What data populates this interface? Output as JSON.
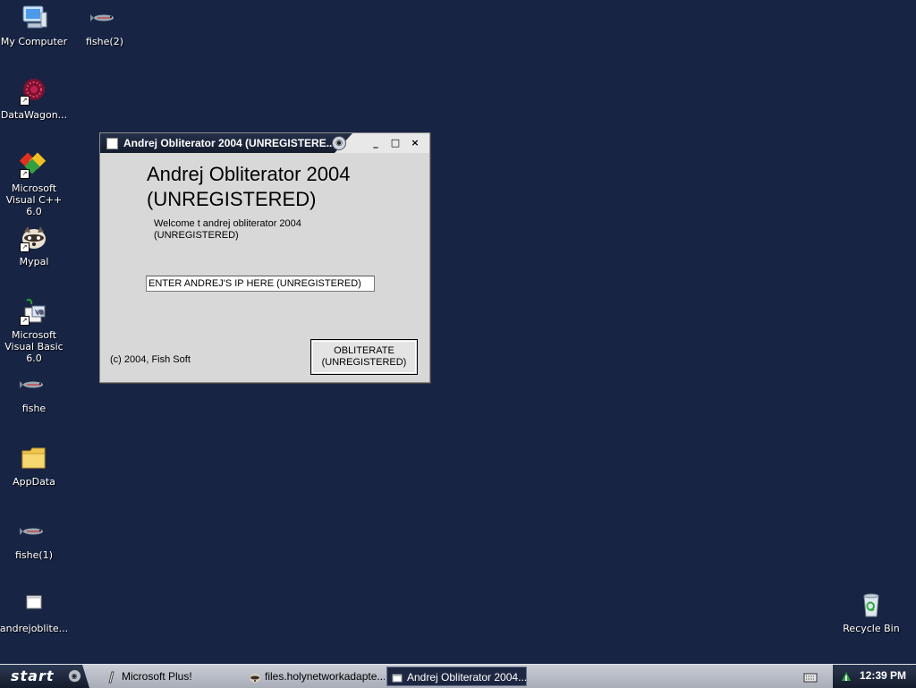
{
  "desktop": {
    "icons": [
      {
        "label": "My Computer",
        "icon": "computer-icon"
      },
      {
        "label": "fishe(2)",
        "icon": "fish-icon"
      },
      {
        "label": "DataWagon...",
        "icon": "datawagon-icon"
      },
      {
        "label": "Microsoft Visual C++ 6.0",
        "icon": "visual-cpp-icon"
      },
      {
        "label": "Mypal",
        "icon": "raccoon-icon"
      },
      {
        "label": "Microsoft Visual Basic 6.0",
        "icon": "visual-basic-icon"
      },
      {
        "label": "fishe",
        "icon": "fish-icon"
      },
      {
        "label": "AppData",
        "icon": "folder-icon"
      },
      {
        "label": "fishe(1)",
        "icon": "fish-icon"
      },
      {
        "label": "andrejoblite...",
        "icon": "file-icon"
      },
      {
        "label": "Recycle Bin",
        "icon": "recycle-bin-icon"
      }
    ]
  },
  "window": {
    "title": "Andrej Obliterator 2004 (UNREGISTERE...",
    "heading_line1": "Andrej Obliterator 2004",
    "heading_line2": "(UNREGISTERED)",
    "welcome_line1": "Welcome t andrej obliterator 2004",
    "welcome_line2": "(UNREGISTERED)",
    "ip_input_value": "ENTER ANDREJ'S IP HERE (UNREGISTERED)",
    "button_line1": "OBLITERATE",
    "button_line2": "(UNREGISTERED)",
    "copyright": "(c) 2004, Fish Soft",
    "controls": {
      "minimize": "_",
      "maximize": "□",
      "close": "×"
    }
  },
  "taskbar": {
    "start_label": "start",
    "tasks": [
      {
        "label": "Microsoft Plus!",
        "icon": "document-icon",
        "active": false
      },
      {
        "label": "files.holynetworkadapte...",
        "icon": "raccoon-icon",
        "active": false
      },
      {
        "label": "Andrej Obliterator 2004...",
        "icon": "app-icon",
        "active": true
      }
    ],
    "clock": "12:39 PM"
  },
  "colors": {
    "desktop_bg": "#172443",
    "taskbar_active": "#1d2741"
  }
}
